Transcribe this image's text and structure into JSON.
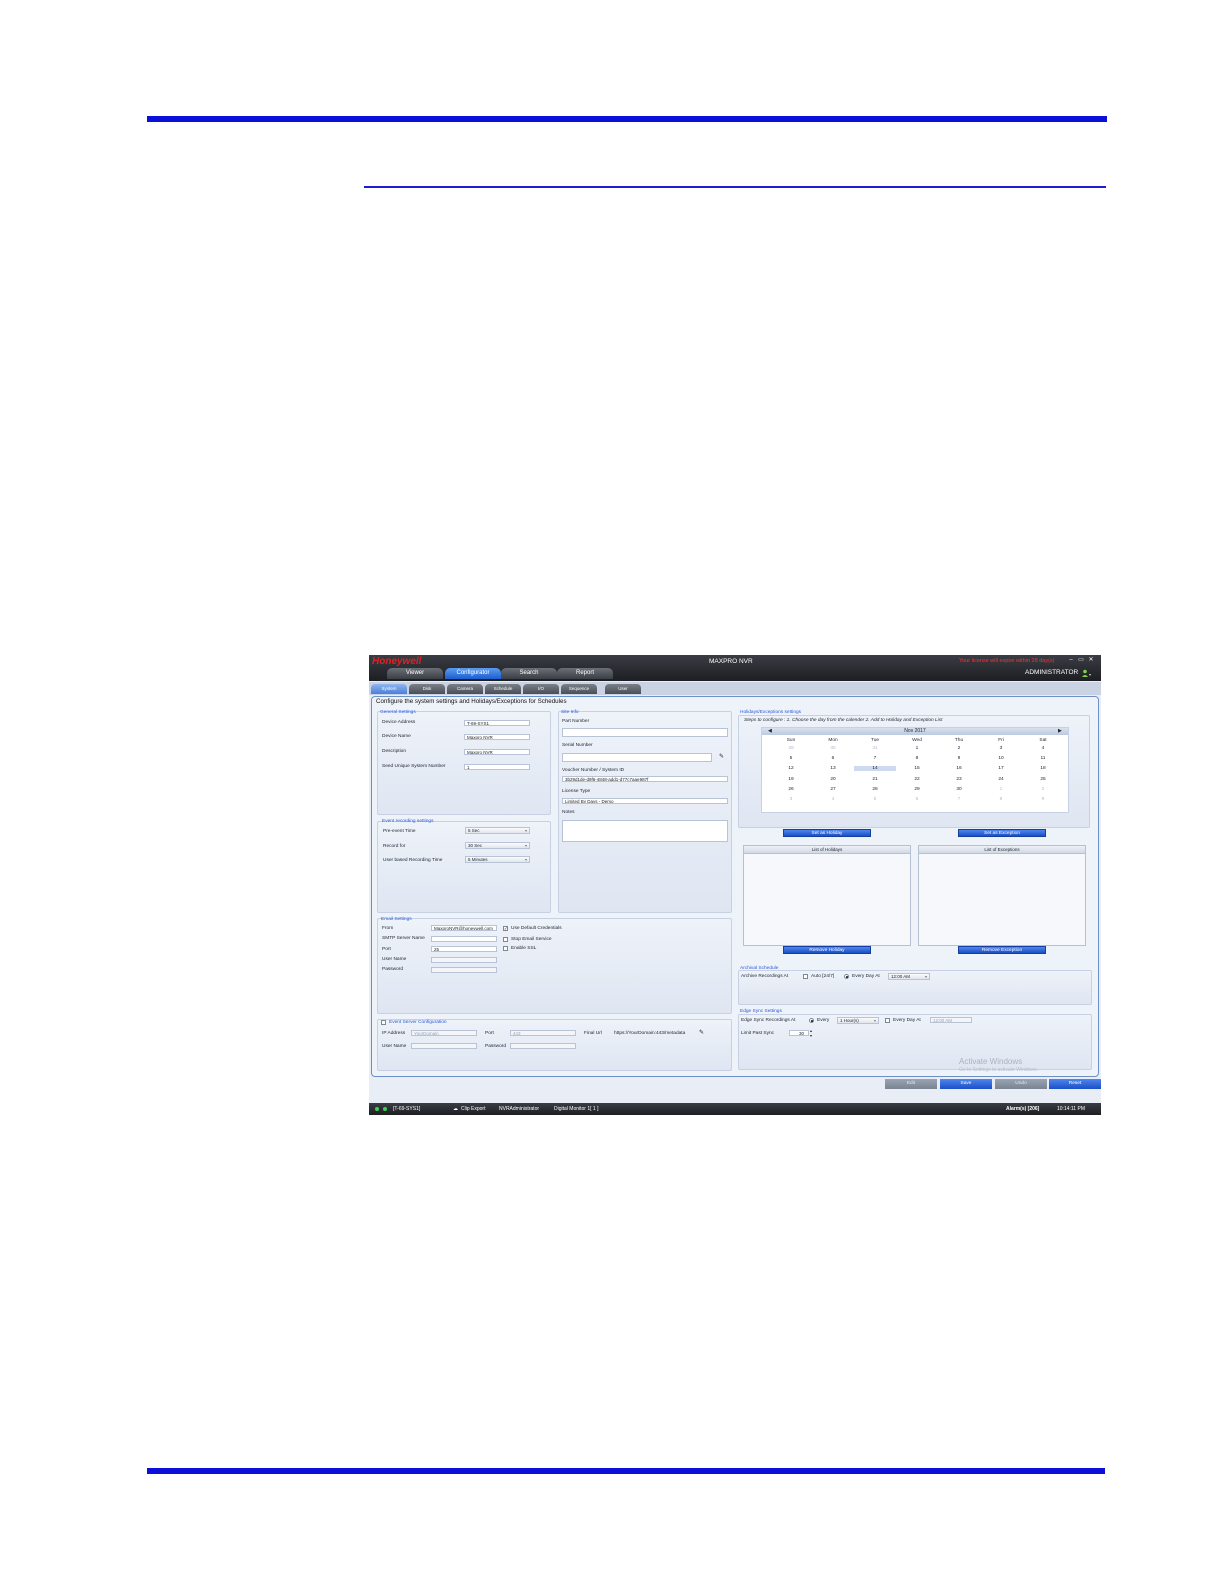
{
  "app": {
    "brand": "Honeywell",
    "title": "MAXPRO NVR",
    "license_warning": "Your license will expire within 28 day(s)",
    "user": "ADMINISTRATOR",
    "main_tabs": [
      "Viewer",
      "Configurator",
      "Search",
      "Report"
    ],
    "sub_tabs": [
      "System",
      "Disk",
      "Camera",
      "Schedule",
      "I/O",
      "Sequence",
      "User"
    ],
    "heading": "Configure the system settings and Holidays/Exceptions for Schedules"
  },
  "general_settings": {
    "title": "General Settings",
    "device_address_label": "Device Address",
    "device_address": "T-69-SYS1",
    "device_name_label": "Device Name",
    "device_name": "Maxpro NVR",
    "description_label": "Description",
    "description": "Maxpro NVR",
    "seed_label": "Seed Unique System Number",
    "seed": "1"
  },
  "site_info": {
    "title": "Site Info",
    "part_number_label": "Part Number",
    "part_number": "",
    "serial_number_label": "Serial Number",
    "serial_number": "",
    "voucher_label": "Voucher Number / System ID",
    "voucher": "3b29d1de-d9f6-4848-add1-d77c7aae987f",
    "license_type_label": "License Type",
    "license_type": "Limited By Days - Demo",
    "notes_label": "Notes"
  },
  "event_recording": {
    "title": "Event recording settings",
    "pre_event_label": "Pre-event Time",
    "pre_event": "5 Sec",
    "record_for_label": "Record for",
    "record_for": "30 Sec",
    "user_based_label": "User based Recording Time",
    "user_based": "5 Minutes"
  },
  "email": {
    "title": "Email Settings",
    "from_label": "From",
    "from": "MaxproNVR@honeywell.com",
    "smtp_label": "SMTP Server Name",
    "port_label": "Port",
    "port": "25",
    "username_label": "User Name",
    "password_label": "Password",
    "use_default_label": "Use Default Credentials",
    "stop_email_label": "Stop Email Service",
    "enable_ssl_label": "Enable SSL"
  },
  "event_server": {
    "title": "Event Server Configuration",
    "ip_label": "IP Address",
    "ip_placeholder": "YourDomain",
    "port_label": "Port",
    "port_placeholder": "443",
    "final_url_label": "Final Url",
    "final_url": "https://YourDomain:443/metadata",
    "username_label": "User Name",
    "password_label": "Password"
  },
  "holidays": {
    "title": "Holidays/Exceptions settings",
    "steps": "Steps to configure : 1. Choose the day from the calender  2. Add to Holiday and Exception List",
    "month": "Nov 2017",
    "prev": "◀",
    "next": "▶",
    "days_of_week": [
      "Sun",
      "Mon",
      "Tue",
      "Wed",
      "Thu",
      "Fri",
      "Sat"
    ],
    "weeks": [
      [
        "29",
        "30",
        "31",
        "1",
        "2",
        "3",
        "4"
      ],
      [
        "5",
        "6",
        "7",
        "8",
        "9",
        "10",
        "11"
      ],
      [
        "12",
        "13",
        "14",
        "15",
        "16",
        "17",
        "18"
      ],
      [
        "19",
        "20",
        "21",
        "22",
        "23",
        "24",
        "25"
      ],
      [
        "26",
        "27",
        "28",
        "29",
        "30",
        "1",
        "2"
      ],
      [
        "3",
        "4",
        "5",
        "6",
        "7",
        "8",
        "9"
      ]
    ],
    "set_holiday": "Set as Holiday",
    "set_exception": "Set as Exception",
    "list_holidays": "List of Holidays",
    "list_exceptions": "List of Exceptions",
    "remove_holiday": "Remove Holiday",
    "remove_exception": "Remove Exception"
  },
  "archival": {
    "title": "Archival Schedule",
    "label": "Archive Recordings At",
    "auto_label": "Auto [24/7]",
    "every_day_label": "Every Day At",
    "time": "12:00 AM"
  },
  "edge_sync": {
    "title": "Edge Sync Settings",
    "label": "Edge Sync Recordings At",
    "every_label": "Every",
    "interval": "1 Hour(s)",
    "every_day_label": "Every Day At",
    "time": "12:00 AM",
    "limit_label": "Limit Past Sync",
    "limit": "30"
  },
  "watermark": {
    "line1": "Activate Windows",
    "line2": "Go to Settings to activate Windows."
  },
  "footer_buttons": [
    "Edit",
    "Save",
    "Undo",
    "Reset"
  ],
  "status_bar": {
    "device": "[T-69-SYS1]",
    "clip_export": "Clip Export",
    "user": "NVRAdministrator",
    "monitor": "Digital Monitor 1[ 1 ]",
    "alarms": "Alarm(s) [206]",
    "time": "10:14:11 PM"
  }
}
